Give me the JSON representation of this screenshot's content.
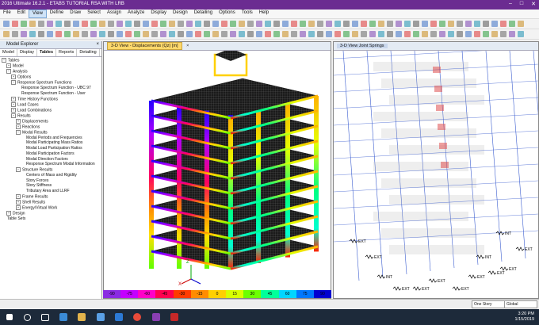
{
  "window": {
    "title": "2016 Ultimate 16.2.1 - ETABS TUTORIAL RSA WITH LRB",
    "min": "–",
    "max": "□",
    "close": "✕"
  },
  "menu": [
    "File",
    "Edit",
    "View",
    "Define",
    "Draw",
    "Select",
    "Assign",
    "Analyze",
    "Display",
    "Design",
    "Detailing",
    "Options",
    "Tools",
    "Help"
  ],
  "explorer": {
    "title": "Model Explorer",
    "tabs": [
      "Model",
      "Display",
      "Tables",
      "Reports",
      "Detailing"
    ],
    "tree": [
      {
        "label": "Tables",
        "level": 0,
        "box": "−"
      },
      {
        "label": "Model",
        "level": 1,
        "box": "+"
      },
      {
        "label": "Analysis",
        "level": 1,
        "box": "−"
      },
      {
        "label": "Options",
        "level": 2,
        "box": "+"
      },
      {
        "label": "Response Spectrum Functions",
        "level": 2,
        "box": "−"
      },
      {
        "label": "Response Spectrum Function - UBC 97",
        "level": 3,
        "box": ""
      },
      {
        "label": "Response Spectrum Function - User",
        "level": 3,
        "box": ""
      },
      {
        "label": "Time History Functions",
        "level": 2,
        "box": "+"
      },
      {
        "label": "Load Cases",
        "level": 2,
        "box": "+"
      },
      {
        "label": "Load Combinations",
        "level": 2,
        "box": "+"
      },
      {
        "label": "Results",
        "level": 2,
        "box": "−"
      },
      {
        "label": "Displacements",
        "level": 3,
        "box": "+"
      },
      {
        "label": "Reactions",
        "level": 3,
        "box": "+"
      },
      {
        "label": "Modal Results",
        "level": 3,
        "box": "−"
      },
      {
        "label": "Modal Periods and Frequencies",
        "level": 4,
        "box": ""
      },
      {
        "label": "Modal Participating Mass Ratios",
        "level": 4,
        "box": ""
      },
      {
        "label": "Modal Load Participation Ratios",
        "level": 4,
        "box": ""
      },
      {
        "label": "Modal Participation Factors",
        "level": 4,
        "box": ""
      },
      {
        "label": "Modal Direction Factors",
        "level": 4,
        "box": ""
      },
      {
        "label": "Response Spectrum Modal Information",
        "level": 4,
        "box": ""
      },
      {
        "label": "Structure Results",
        "level": 3,
        "box": "−"
      },
      {
        "label": "Centers of Mass and Rigidity",
        "level": 4,
        "box": ""
      },
      {
        "label": "Story Forces",
        "level": 4,
        "box": ""
      },
      {
        "label": "Story Stiffness",
        "level": 4,
        "box": ""
      },
      {
        "label": "Tributary Area and LLRF",
        "level": 4,
        "box": ""
      },
      {
        "label": "Frame Results",
        "level": 3,
        "box": "+"
      },
      {
        "label": "Shell Results",
        "level": 3,
        "box": "+"
      },
      {
        "label": "Energy/Virtual Work",
        "level": 3,
        "box": "+"
      },
      {
        "label": "Design",
        "level": 1,
        "box": "+"
      },
      {
        "label": "Table Sets",
        "level": 0,
        "box": ""
      }
    ]
  },
  "pane_left": {
    "title": "3-D View - Displacements (Qz) [m]"
  },
  "pane_right": {
    "title": "3-D View  Joint Springs"
  },
  "legend": {
    "values": [
      "-90",
      "-75",
      "-60",
      "-45",
      "-30",
      "-15",
      "0",
      "15",
      "30",
      "45",
      "60",
      "75",
      "90"
    ],
    "colors": [
      "#8a2be2",
      "#c400ff",
      "#ff00c8",
      "#ff0050",
      "#ff3b00",
      "#ff8c00",
      "#ffd000",
      "#d8ff00",
      "#6cff00",
      "#00ff9a",
      "#00d6ff",
      "#0078ff",
      "#0000d0"
    ]
  },
  "spring_labels": [
    "EXT",
    "INT",
    "INT",
    "EXT",
    "EXT",
    "INT",
    "EXT",
    "EXT",
    "EXT",
    "EXT",
    "EXT",
    "EXT",
    "EXT"
  ],
  "status": {
    "story": "One Story",
    "coord": "Global"
  },
  "clock": {
    "time": "3:20 PM",
    "date": "1/15/2019"
  },
  "colors": {
    "title_bar": "#6b2c91",
    "grid_line": "#3d5fd0",
    "floor": "#222222"
  }
}
